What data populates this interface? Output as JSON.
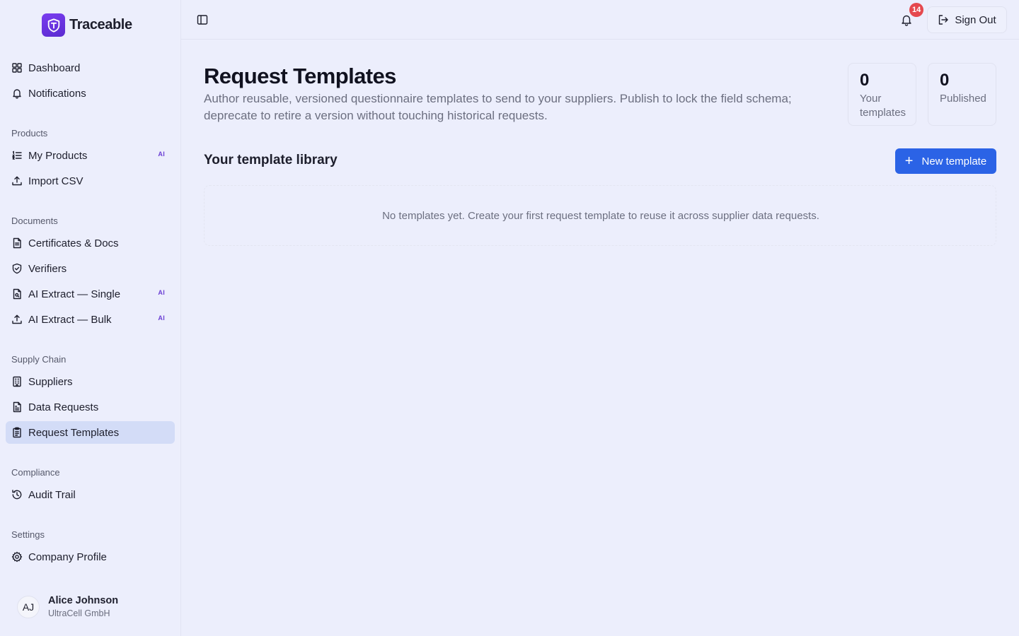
{
  "brand": {
    "name": "Traceable"
  },
  "nav": {
    "dashboard": "Dashboard",
    "notifications": "Notifications",
    "products_label": "Products",
    "my_products": "My Products",
    "import_csv": "Import CSV",
    "documents_label": "Documents",
    "certificates": "Certificates & Docs",
    "verifiers": "Verifiers",
    "ai_single": "AI Extract — Single",
    "ai_bulk": "AI Extract — Bulk",
    "supply_label": "Supply Chain",
    "suppliers": "Suppliers",
    "data_requests": "Data Requests",
    "request_templates": "Request Templates",
    "compliance_label": "Compliance",
    "audit_trail": "Audit Trail",
    "settings_label": "Settings",
    "company_profile": "Company Profile",
    "ai_badge": "AI"
  },
  "user": {
    "initials": "AJ",
    "name": "Alice Johnson",
    "company": "UltraCell GmbH"
  },
  "topbar": {
    "notification_count": "14",
    "sign_out": "Sign Out"
  },
  "page": {
    "title": "Request Templates",
    "description": "Author reusable, versioned questionnaire templates to send to your suppliers. Publish to lock the field schema; deprecate to retire a version without touching historical requests."
  },
  "stats": {
    "your_templates": {
      "value": "0",
      "label": "Your templates"
    },
    "published": {
      "value": "0",
      "label": "Published"
    }
  },
  "library": {
    "title": "Your template library",
    "new_button": "New template",
    "empty": "No templates yet. Create your first request template to reuse it across supplier data requests."
  },
  "colors": {
    "accent": "#2b63e6",
    "brand": "#6b3fd4",
    "active_nav": "#d3dcf7",
    "badge": "#e5484d"
  }
}
